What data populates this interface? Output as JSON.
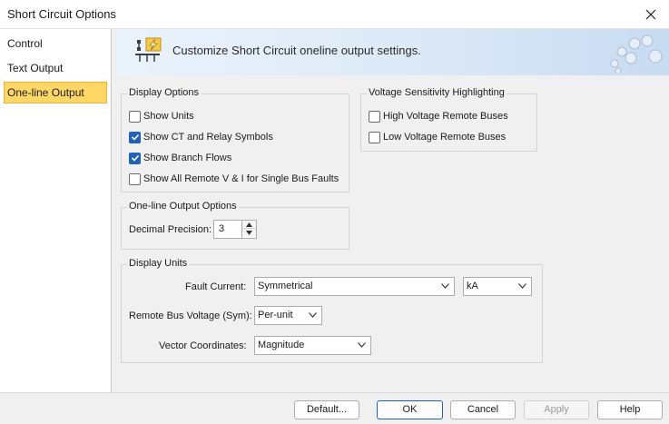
{
  "window": {
    "title": "Short Circuit Options"
  },
  "sidebar": {
    "items": [
      {
        "label": "Control",
        "active": false
      },
      {
        "label": "Text Output",
        "active": false
      },
      {
        "label": "One-line Output",
        "active": true
      }
    ]
  },
  "banner": {
    "text": "Customize Short Circuit oneline output settings."
  },
  "display_options": {
    "title": "Display Options",
    "items": [
      {
        "label": "Show Units",
        "checked": false
      },
      {
        "label": "Show CT and Relay Symbols",
        "checked": true
      },
      {
        "label": "Show Branch Flows",
        "checked": true
      },
      {
        "label": "Show All Remote V & I for Single Bus Faults",
        "checked": false
      }
    ]
  },
  "voltage_sensitivity": {
    "title": "Voltage Sensitivity Highlighting",
    "items": [
      {
        "label": "High Voltage Remote Buses",
        "checked": false
      },
      {
        "label": "Low Voltage Remote Buses",
        "checked": false
      }
    ]
  },
  "oneline_output_options": {
    "title": "One-line Output Options",
    "decimal_precision_label": "Decimal Precision:",
    "decimal_precision_value": "3"
  },
  "display_units": {
    "title": "Display Units",
    "fault_current_label": "Fault Current:",
    "fault_current_value": "Symmetrical",
    "fault_current_unit": "kA",
    "remote_bus_voltage_label": "Remote Bus Voltage (Sym):",
    "remote_bus_voltage_value": "Per-unit",
    "vector_coordinates_label": "Vector Coordinates:",
    "vector_coordinates_value": "Magnitude"
  },
  "footer": {
    "default_label": "Default...",
    "ok_label": "OK",
    "cancel_label": "Cancel",
    "apply_label": "Apply",
    "help_label": "Help"
  },
  "colors": {
    "accent": "#1f62b8",
    "selected_nav": "#fed766",
    "banner": "#dde9f7"
  }
}
